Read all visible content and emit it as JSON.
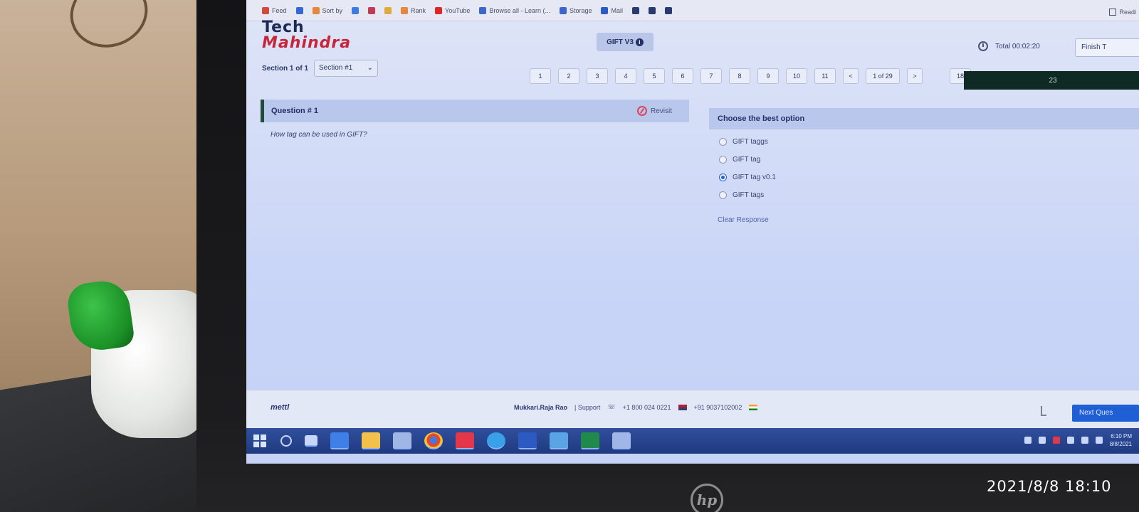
{
  "browser": {
    "bookmarks": [
      {
        "label": "Feed",
        "icon": "bookmark-icon",
        "color": "#d24a3c"
      },
      {
        "label": "",
        "icon": "google-icon",
        "color": "#3568d4"
      },
      {
        "label": "Sort by",
        "icon": "bookmark-icon",
        "color": "#e8873a"
      },
      {
        "label": "",
        "icon": "chrome-icon",
        "color": "#3d7be2"
      },
      {
        "label": "",
        "icon": "bookmark-icon",
        "color": "#c23a55"
      },
      {
        "label": "",
        "icon": "bookmark-icon",
        "color": "#e1a93a"
      },
      {
        "label": "Rank",
        "icon": "bookmark-icon",
        "color": "#e8873a"
      },
      {
        "label": "YouTube",
        "icon": "youtube-icon",
        "color": "#e0242b"
      },
      {
        "label": "Browse all - Learn (...",
        "icon": "microsoft-icon",
        "color": "#3a67c9"
      },
      {
        "label": "Storage",
        "icon": "microsoft-icon",
        "color": "#3a67c9"
      },
      {
        "label": "Mail",
        "icon": "mail-icon",
        "color": "#2a5bc7"
      },
      {
        "label": "",
        "icon": "bookmark-icon",
        "color": "#2b3a6e"
      },
      {
        "label": "",
        "icon": "bookmark-icon",
        "color": "#2b3a6e"
      },
      {
        "label": "",
        "icon": "bookmark-icon",
        "color": "#2b3a6e"
      }
    ],
    "reading_list": "Readi"
  },
  "header": {
    "brand_top": "Tech",
    "brand_bottom": "Mahindra",
    "test_name": "GIFT V3",
    "timer": "Total 00:02:20",
    "finish_label": "Finish T"
  },
  "section": {
    "label": "Section 1 of 1",
    "selected": "Section #1"
  },
  "question_nav": {
    "numbers": [
      "1",
      "2",
      "3",
      "4",
      "5",
      "6",
      "7",
      "8",
      "9",
      "10",
      "11"
    ],
    "prev": "<",
    "page": "1 of 29",
    "next": ">",
    "left_count": "18",
    "progress_label": "23"
  },
  "question": {
    "title": "Question # 1",
    "revisit": "Revisit",
    "text": "How tag can be used in GIFT?"
  },
  "answers": {
    "header": "Choose the best option",
    "options": [
      {
        "label": "GIFT taggs",
        "checked": false
      },
      {
        "label": "GIFT tag",
        "checked": false
      },
      {
        "label": "GIFT tag v0.1",
        "checked": true
      },
      {
        "label": "GIFT tags",
        "checked": false
      }
    ],
    "clear": "Clear Response"
  },
  "footer": {
    "logo": "mettl",
    "candidate": "Mukkari.Raja Rao",
    "support": "| Support",
    "phone_india": "+1 800 024 0221",
    "phone_intl": "+91 9037102002",
    "next_label": "Next Ques"
  },
  "taskbar": {
    "time": "6:10 PM",
    "date": "8/8/2021"
  },
  "photo": {
    "timestamp": "2021/8/8 18:10"
  },
  "laptop": {
    "logo": "hp"
  }
}
